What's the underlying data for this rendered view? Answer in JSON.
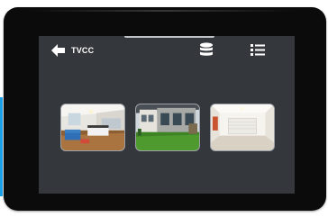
{
  "device": {
    "accent_color": "#1aa0e8",
    "bezel_color": "#0b0b0c",
    "screen_color": "#34383d"
  },
  "header": {
    "back_icon": "arrow-left-icon",
    "title": "TVCC",
    "storage_icon": "database-icon",
    "menu_icon": "list-menu-icon"
  },
  "gallery": {
    "items": [
      {
        "icon": "photo-thumbnail",
        "subject": "interior-living-kitchen"
      },
      {
        "icon": "photo-thumbnail",
        "subject": "exterior-house-garden"
      },
      {
        "icon": "photo-thumbnail",
        "subject": "empty-garage-room"
      }
    ]
  }
}
